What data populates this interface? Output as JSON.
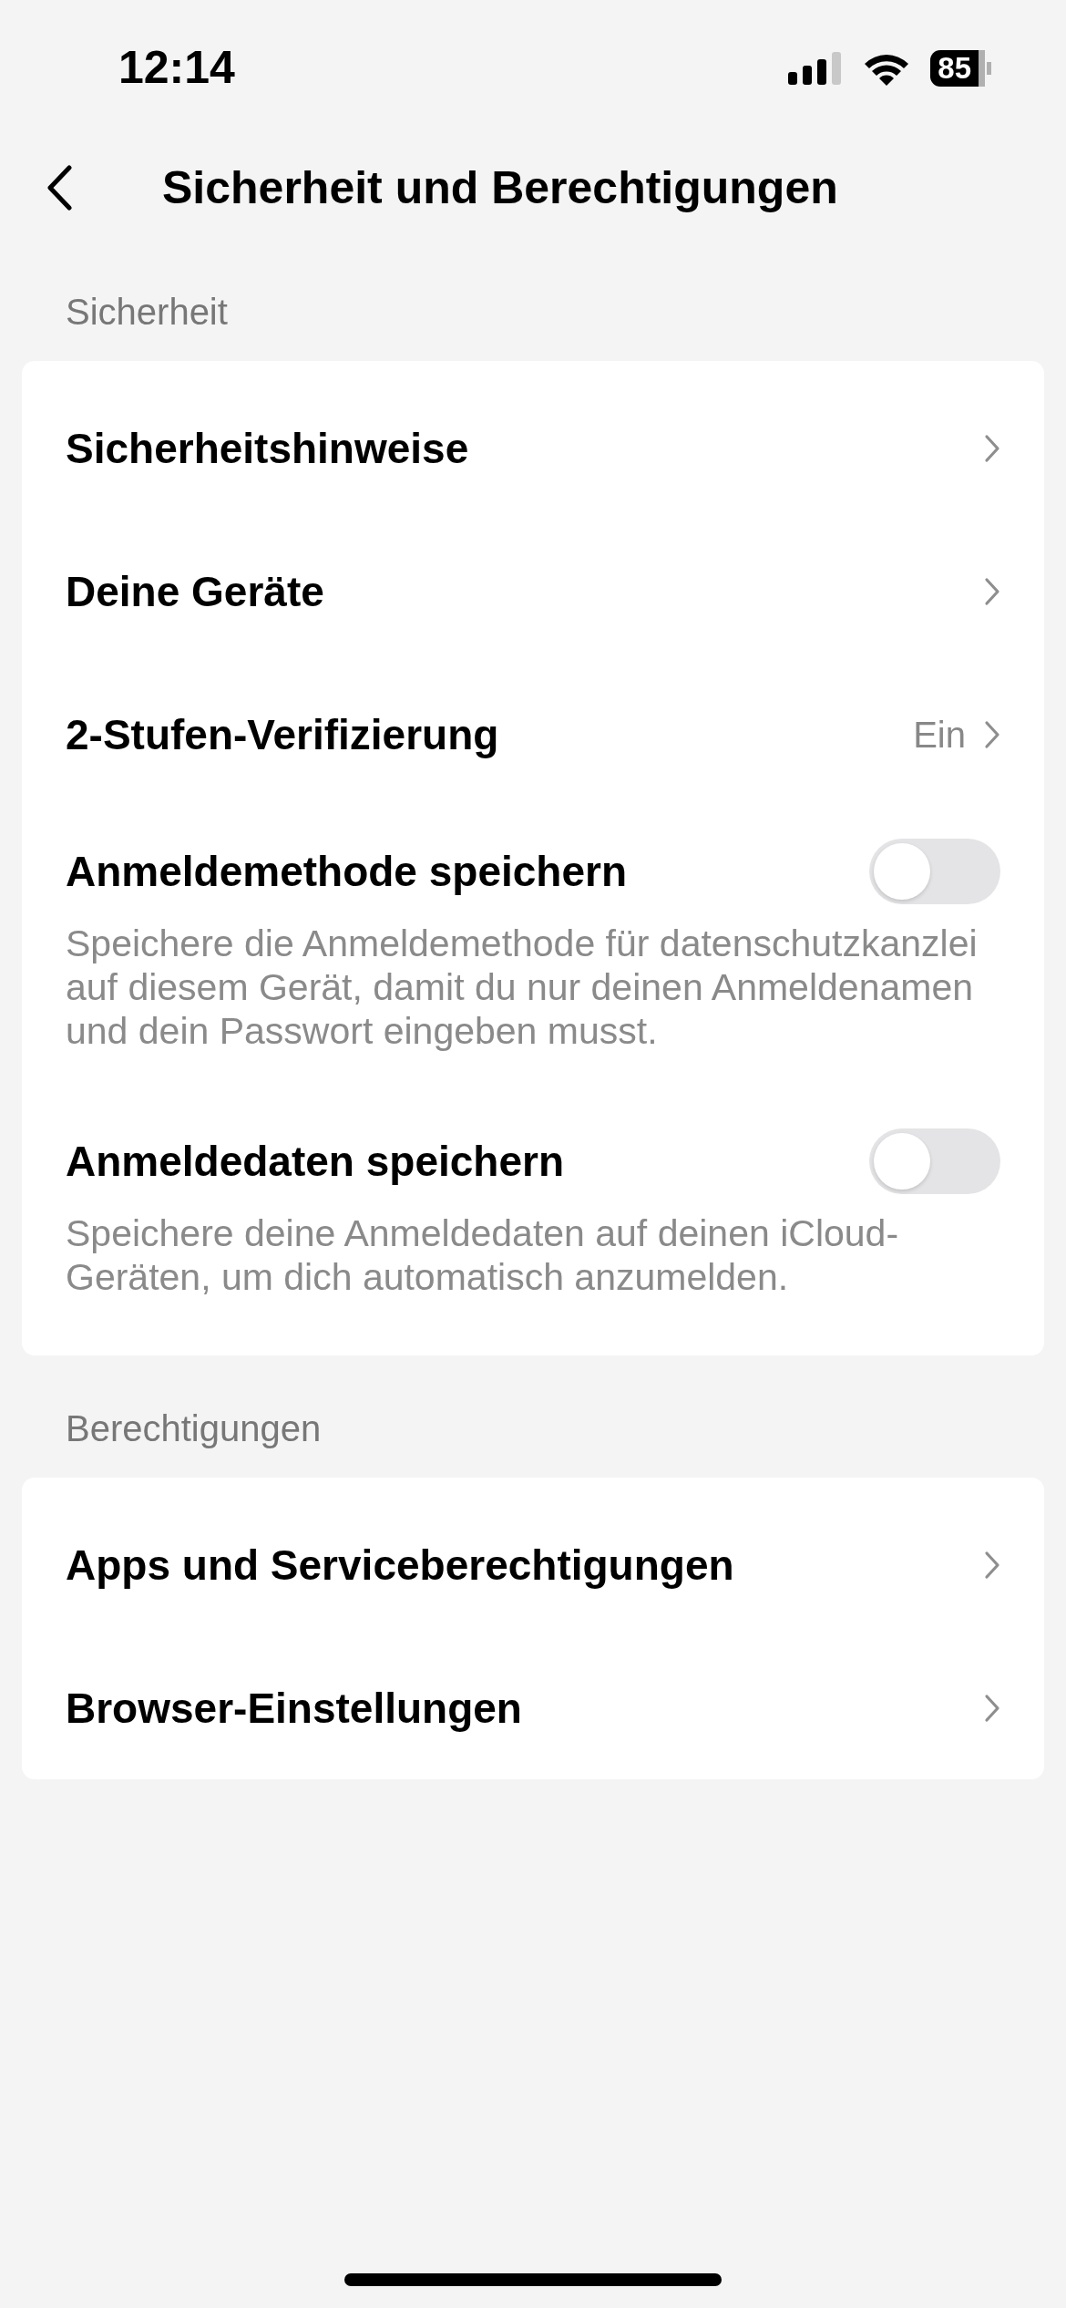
{
  "status_bar": {
    "time": "12:14",
    "battery": "85"
  },
  "header": {
    "title": "Sicherheit und Berechtigungen"
  },
  "sections": [
    {
      "title": "Sicherheit",
      "items": [
        {
          "kind": "link",
          "label": "Sicherheitshinweise"
        },
        {
          "kind": "link",
          "label": "Deine Geräte"
        },
        {
          "kind": "link",
          "label": "2-Stufen-Verifizierung",
          "value": "Ein"
        },
        {
          "kind": "toggle",
          "label": "Anmeldemethode speichern",
          "on": false,
          "description": "Speichere die Anmeldemethode für datenschutzkanzlei auf diesem Gerät, damit du nur deinen Anmeldenamen und dein Passwort eingeben musst."
        },
        {
          "kind": "toggle",
          "label": "Anmeldedaten speichern",
          "on": false,
          "description": "Speichere deine Anmeldedaten auf deinen iCloud-Geräten, um dich automatisch anzumelden."
        }
      ]
    },
    {
      "title": "Berechtigungen",
      "items": [
        {
          "kind": "link",
          "label": "Apps und Serviceberechtigungen"
        },
        {
          "kind": "link",
          "label": "Browser-Einstellungen"
        }
      ]
    }
  ]
}
